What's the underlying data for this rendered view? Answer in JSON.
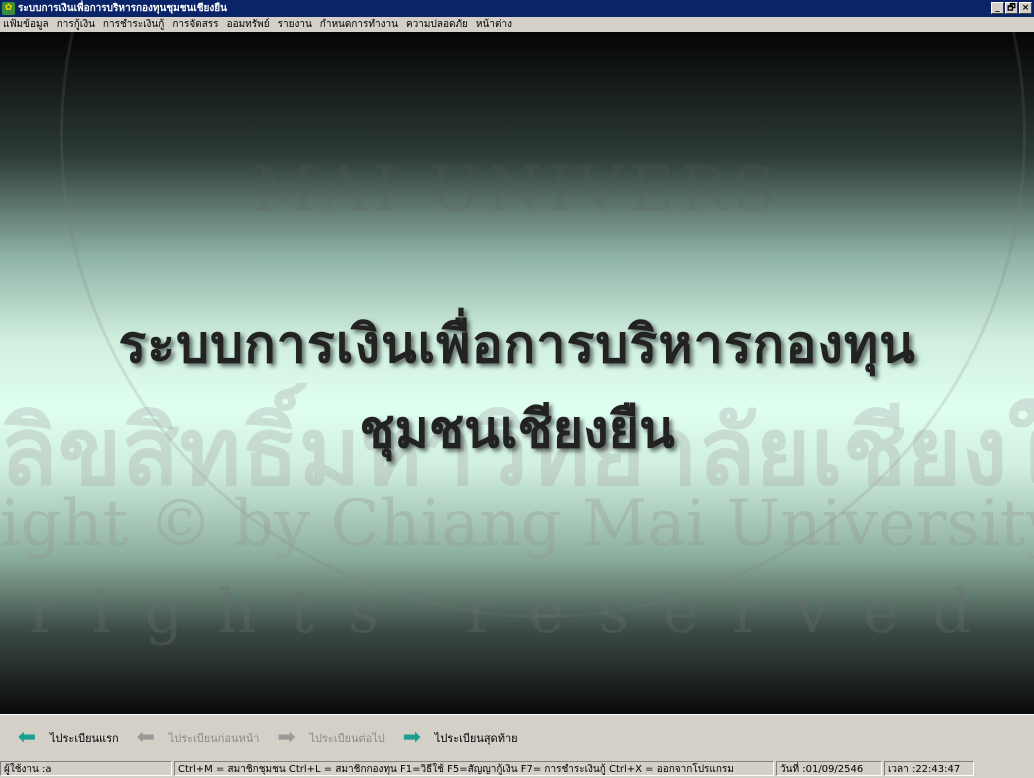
{
  "window": {
    "title": "ระบบการเงินเพื่อการบริหารกองทุนชุมชนเชียงยืน",
    "minimize": "_",
    "maximize": "🗗",
    "close": "×"
  },
  "menu": [
    "แฟ้มข้อมูล",
    "การกู้เงิน",
    "การชำระเงินกู้",
    "การจัดสรร",
    "ออมทรัพย์",
    "รายงาน",
    "กำหนดการทำงาน",
    "ความปลอดภัย",
    "หน้าต่าง"
  ],
  "splash": {
    "line1": "ระบบการเงินเพื่อการบริหารกองทุน",
    "line2": "ชุมชนเชียงยืน"
  },
  "watermark": {
    "university": "MAI UNIVERS",
    "thai": "ลิขสิทธิ์มหาวิทยาลัยเชียงใหม่",
    "copyright": "ight © by Chiang Mai University",
    "rights": "rights reserved"
  },
  "nav": {
    "first": "ไประเบียนแรก",
    "prev": "ไประเบียนก่อนหน้า",
    "next": "ไประเบียนต่อไป",
    "last": "ไประเบียนสุดท้าย"
  },
  "status": {
    "user": "ผู้ใช้งาน :a",
    "shortcuts": "Ctrl+M = สมาชิกชุมชน  Ctrl+L = สมาชิกกองทุน  F1=วิธีใช้   F5=สัญญากู้เงิน   F7= การชำระเงินกู้   Ctrl+X = ออกจากโปรแกรม",
    "date": "วันที่ :01/09/2546",
    "time": "เวลา :22:43:47"
  },
  "colors": {
    "titlebar": "#0a246a",
    "arrow_active": "#1aa08c",
    "arrow_disabled": "#9a9a9a",
    "chrome": "#d4d0c8"
  }
}
